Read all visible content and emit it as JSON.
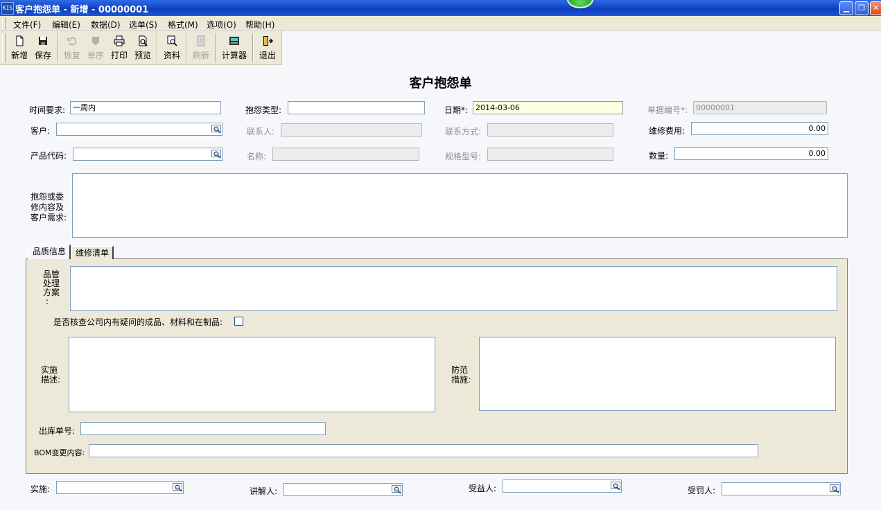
{
  "window": {
    "title": "客户抱怨单 - 新增 - 00000001",
    "logo": "KIS",
    "controls": [
      "minimize-icon",
      "restore-icon",
      "close-icon"
    ]
  },
  "menu": [
    {
      "label": "文件(F)"
    },
    {
      "label": "编辑(E)"
    },
    {
      "label": "数据(D)"
    },
    {
      "label": "选单(S)"
    },
    {
      "label": "格式(M)"
    },
    {
      "label": "选项(O)"
    },
    {
      "label": "帮助(H)"
    }
  ],
  "toolbar": {
    "new": "新增",
    "save": "保存",
    "restore": "恢复",
    "sequence": "单序",
    "print": "打印",
    "preview": "预览",
    "data": "资料",
    "refresh": "刷新",
    "calculator": "计算器",
    "exit": "退出"
  },
  "form": {
    "title": "客户抱怨单",
    "time_req_label": "时间要求:",
    "time_req_value": "一周内",
    "complaint_type_label": "抱怨类型:",
    "complaint_type_value": "",
    "date_label": "日期*:",
    "date_value": "2014-03-06",
    "doc_no_label": "单据编号*:",
    "doc_no_value": "00000001",
    "customer_label": "客户:",
    "customer_value": "",
    "contact_label": "联系人:",
    "contact_value": "",
    "contact_method_label": "联系方式:",
    "contact_method_value": "",
    "repair_cost_label": "维修费用:",
    "repair_cost_value": "0.00",
    "product_code_label": "产品代码:",
    "product_code_value": "",
    "name_label": "名称:",
    "name_value": "",
    "spec_label": "规格型号:",
    "spec_value": "",
    "qty_label": "数量:",
    "qty_value": "0.00",
    "complaint_content_label_1": "抱怨或委",
    "complaint_content_label_2": "修内容及",
    "complaint_content_label_3": "客户需求:"
  },
  "tabs": {
    "quality": "品质信息",
    "repair_list": "维修清单"
  },
  "quality": {
    "plan_label_1": "品管",
    "plan_label_2": "处理",
    "plan_label_3": "方案",
    "plan_label_4": ":",
    "check_label": "是否核查公司内有疑问的成品、材料和在制品:",
    "check_value": false,
    "impl_label_1": "实施",
    "impl_label_2": "描述:",
    "prevent_label_1": "防范",
    "prevent_label_2": "措施:",
    "outbound_label": "出库单号:",
    "outbound_value": "",
    "bom_label": "BOM变更内容:",
    "bom_value": ""
  },
  "footer": {
    "implement_label": "实施:",
    "implement_value": "",
    "explainer_label": "讲解人:",
    "explainer_value": "",
    "beneficiary_label": "受益人:",
    "beneficiary_value": "",
    "penalized_label": "受罚人:",
    "penalized_value": ""
  }
}
